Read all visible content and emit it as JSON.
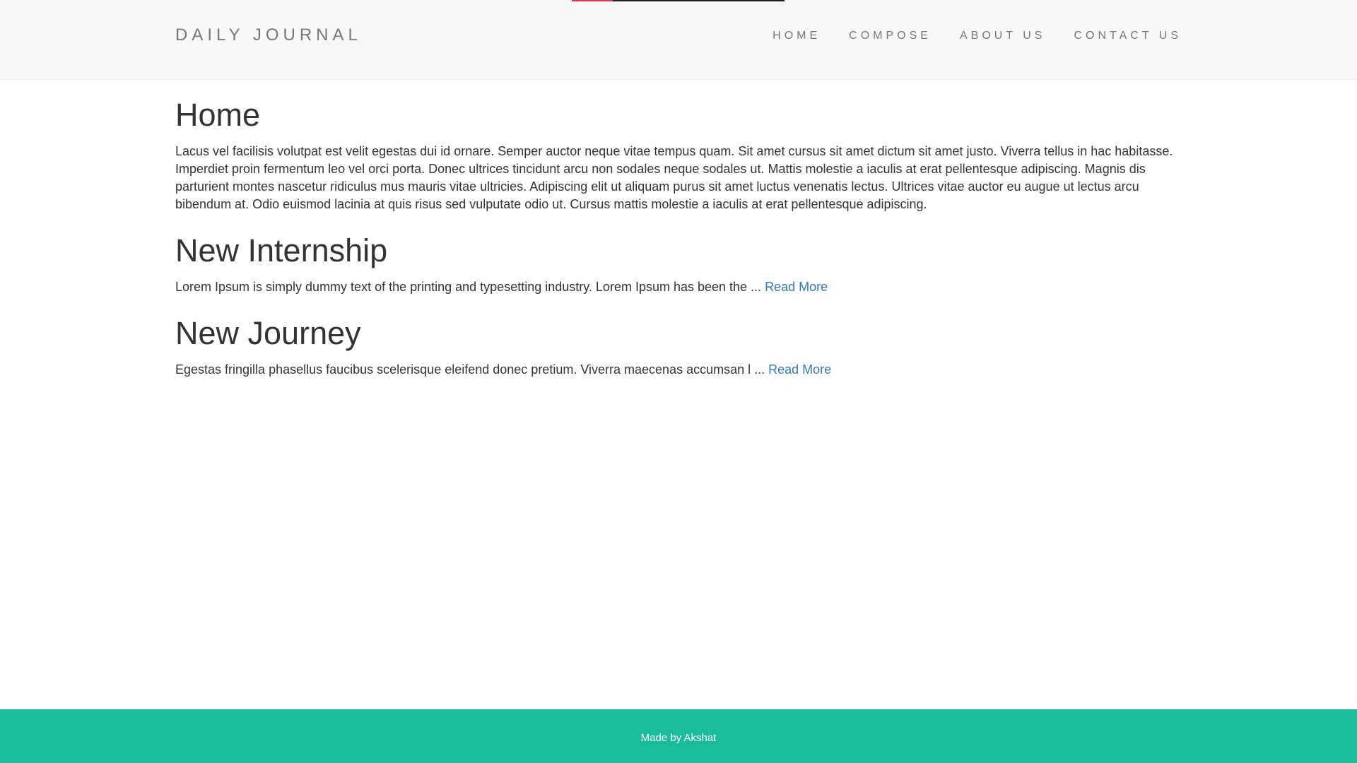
{
  "navbar": {
    "brand": "DAILY JOURNAL",
    "links": [
      {
        "label": "HOME"
      },
      {
        "label": "COMPOSE"
      },
      {
        "label": "ABOUT US"
      },
      {
        "label": "CONTACT US"
      }
    ]
  },
  "main": {
    "title": "Home",
    "intro": "Lacus vel facilisis volutpat est velit egestas dui id ornare. Semper auctor neque vitae tempus quam. Sit amet cursus sit amet dictum sit amet justo. Viverra tellus in hac habitasse. Imperdiet proin fermentum leo vel orci porta. Donec ultrices tincidunt arcu non sodales neque sodales ut. Mattis molestie a iaculis at erat pellentesque adipiscing. Magnis dis parturient montes nascetur ridiculus mus mauris vitae ultricies. Adipiscing elit ut aliquam purus sit amet luctus venenatis lectus. Ultrices vitae auctor eu augue ut lectus arcu bibendum at. Odio euismod lacinia at quis risus sed vulputate odio ut. Cursus mattis molestie a iaculis at erat pellentesque adipiscing.",
    "posts": [
      {
        "title": "New Internship",
        "excerpt": "Lorem Ipsum is simply dummy text of the printing and typesetting industry. Lorem Ipsum has been the ...",
        "read_more": "Read More"
      },
      {
        "title": "New Journey",
        "excerpt": "Egestas fringilla phasellus faucibus scelerisque eleifend donec pretium. Viverra maecenas accumsan l ...",
        "read_more": "Read More"
      }
    ]
  },
  "footer": {
    "text": "Made by Akshat"
  },
  "colors": {
    "navbar_bg": "#f8f8f8",
    "link": "#337ab7",
    "footer_bg": "#1abc9c",
    "top_strip_accent": "#e0344a"
  }
}
